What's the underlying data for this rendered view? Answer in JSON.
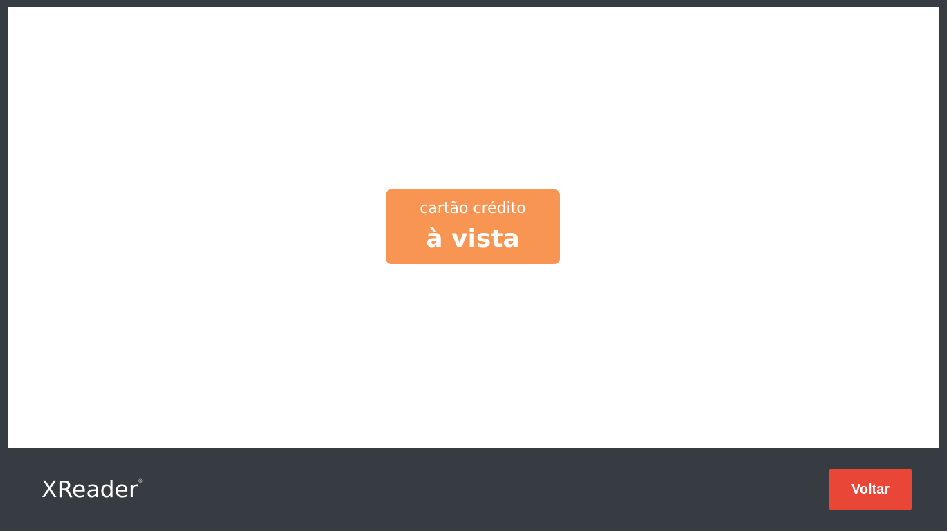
{
  "colors": {
    "background": "#373b42",
    "panel": "#ffffff",
    "option_accent": "#f99553",
    "back_button": "#ea4637"
  },
  "payment_option": {
    "line1": "cartão crédito",
    "line2": "à vista"
  },
  "footer": {
    "logo_text": "XReader",
    "logo_mark": "®",
    "back_label": "Voltar"
  }
}
